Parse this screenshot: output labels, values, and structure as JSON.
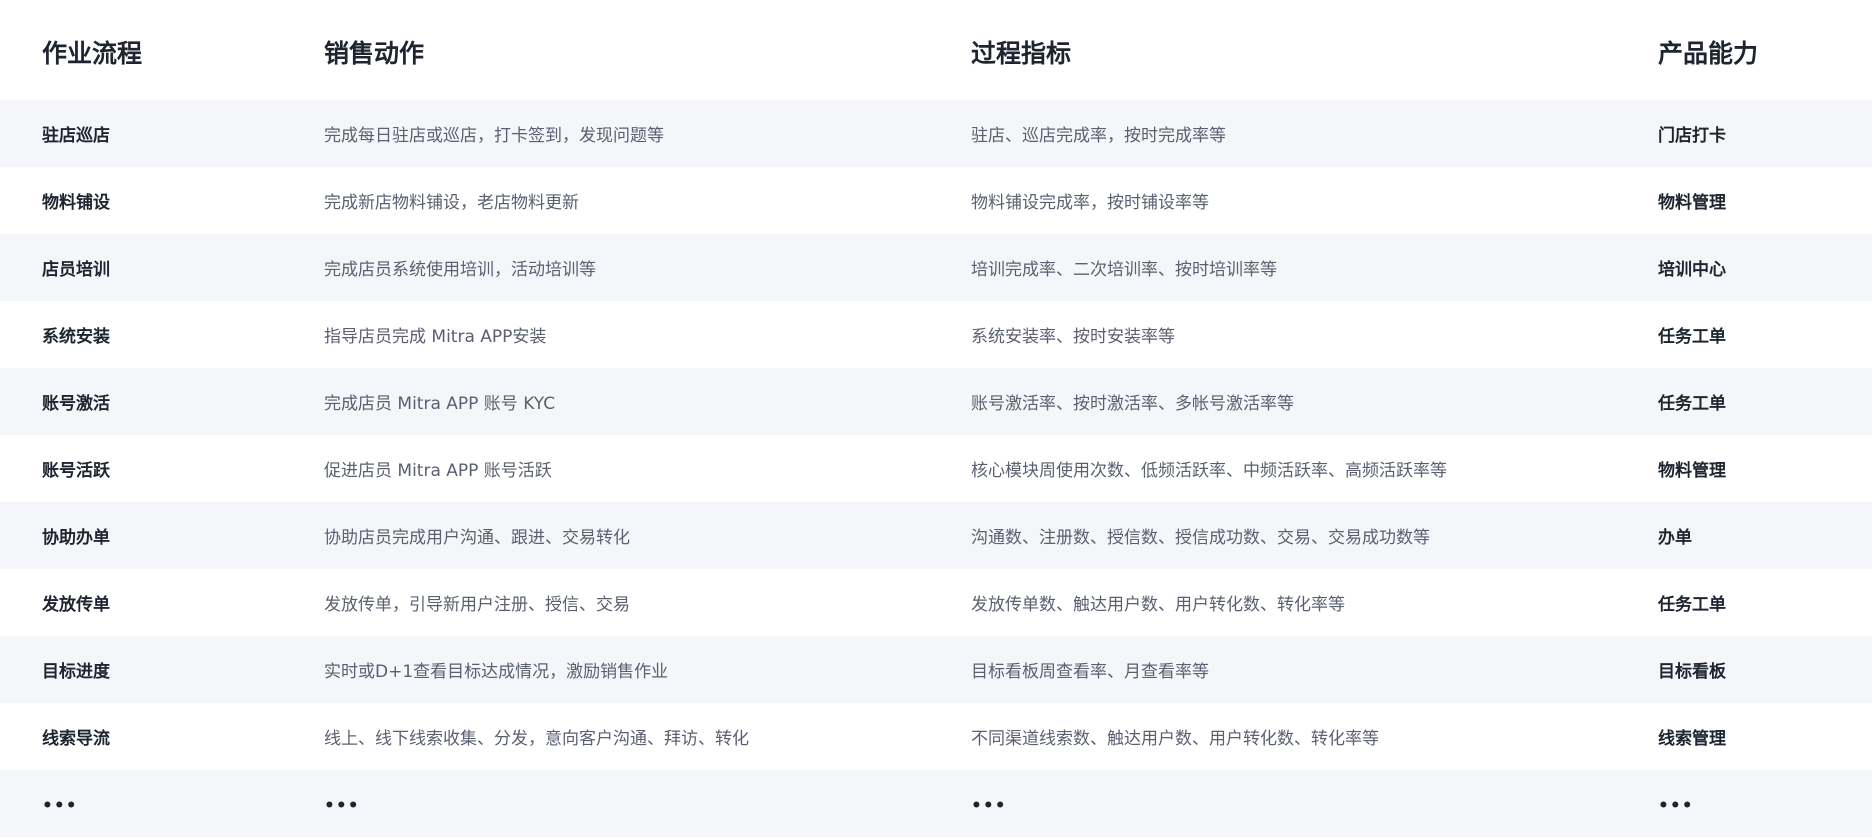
{
  "headers": [
    "作业流程",
    "销售动作",
    "过程指标",
    "产品能力"
  ],
  "rows": [
    {
      "process": "驻店巡店",
      "action": "完成每日驻店或巡店，打卡签到，发现问题等",
      "metric": "驻店、巡店完成率，按时完成率等",
      "capability": "门店打卡"
    },
    {
      "process": "物料铺设",
      "action": "完成新店物料铺设，老店物料更新",
      "metric": "物料铺设完成率，按时铺设率等",
      "capability": "物料管理"
    },
    {
      "process": "店员培训",
      "action": "完成店员系统使用培训，活动培训等",
      "metric": "培训完成率、二次培训率、按时培训率等",
      "capability": "培训中心"
    },
    {
      "process": "系统安装",
      "action": "指导店员完成 Mitra APP安装",
      "metric": "系统安装率、按时安装率等",
      "capability": "任务工单"
    },
    {
      "process": "账号激活",
      "action": "完成店员 Mitra APP 账号 KYC",
      "metric": "账号激活率、按时激活率、多帐号激活率等",
      "capability": "任务工单"
    },
    {
      "process": "账号活跃",
      "action": "促进店员 Mitra APP 账号活跃",
      "metric": "核心模块周使用次数、低频活跃率、中频活跃率、高频活跃率等",
      "capability": "物料管理"
    },
    {
      "process": "协助办单",
      "action": "协助店员完成用户沟通、跟进、交易转化",
      "metric": "沟通数、注册数、授信数、授信成功数、交易、交易成功数等",
      "capability": "办单"
    },
    {
      "process": "发放传单",
      "action": "发放传单，引导新用户注册、授信、交易",
      "metric": "发放传单数、触达用户数、用户转化数、转化率等",
      "capability": "任务工单"
    },
    {
      "process": "目标进度",
      "action": "实时或D+1查看目标达成情况，激励销售作业",
      "metric": "目标看板周查看率、月查看率等",
      "capability": "目标看板"
    },
    {
      "process": "线索导流",
      "action": "线上、线下线索收集、分发，意向客户沟通、拜访、转化",
      "metric": "不同渠道线索数、触达用户数、用户转化数、转化率等",
      "capability": "线索管理"
    }
  ],
  "ellipsis": "•••"
}
